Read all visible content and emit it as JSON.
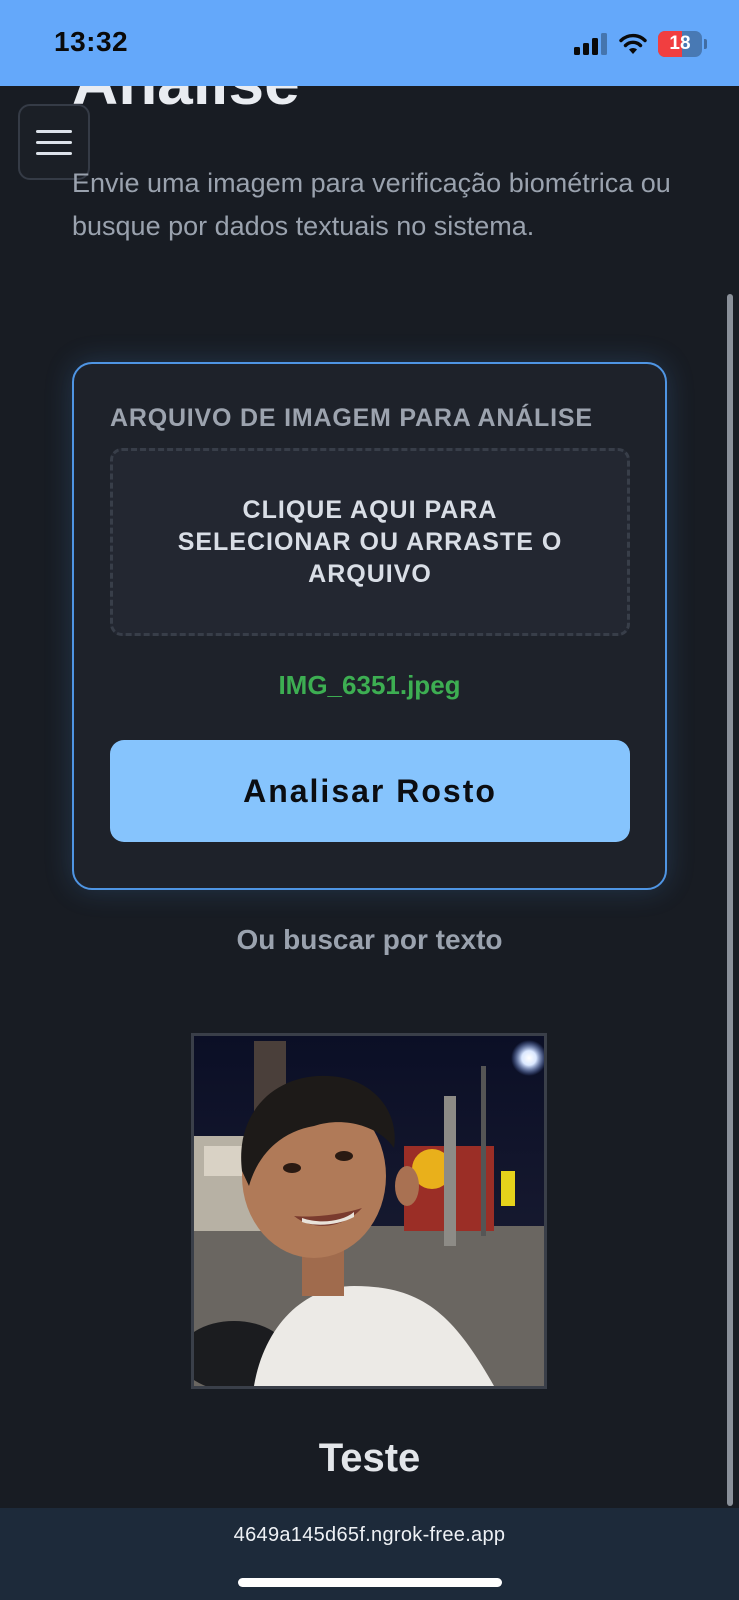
{
  "status_bar": {
    "time": "13:32",
    "battery": "18",
    "battery_level": 0.18,
    "icons": [
      "signal-icon",
      "wifi-icon",
      "battery-icon"
    ]
  },
  "page": {
    "heading": "Análise",
    "description": "Envie uma imagem para verificação biométrica ou busque por dados textuais no sistema.",
    "menu_icon": "hamburger-menu-icon"
  },
  "upload": {
    "label": "ARQUIVO DE IMAGEM PARA ANÁLISE",
    "dropzone_text": "CLIQUE AQUI PARA SELECIONAR OU ARRASTE O ARQUIVO",
    "filename": "IMG_6351.jpeg",
    "button_label": "Analisar Rosto"
  },
  "alt_search": {
    "label": "Ou buscar por texto"
  },
  "result": {
    "name": "Teste"
  },
  "browser": {
    "url": "4649a145d65f.ngrok-free.app"
  },
  "colors": {
    "status_bar": "#64a8fa",
    "background": "#181c23",
    "accent_border": "#4f95e3",
    "button": "#86c4fd",
    "filename": "#3dae52",
    "battery_low": "#f13e40"
  }
}
